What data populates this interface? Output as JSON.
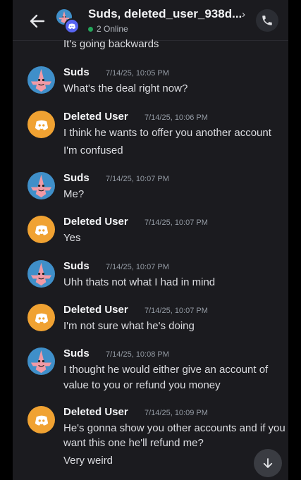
{
  "header": {
    "title": "Suds, deleted_user_938d...",
    "online": "2 Online"
  },
  "colors": {
    "background": "#1b1b1f",
    "discord_blurple": "#5865f2",
    "deleted_avatar": "#f0a232",
    "online_green": "#23a55a"
  },
  "messages": {
    "top_continuation": "It's going backwards",
    "m1": {
      "author": "Suds",
      "time": "7/14/25, 10:05 PM",
      "lines": [
        "What's the deal right now?"
      ]
    },
    "m2": {
      "author": "Deleted User",
      "time": "7/14/25, 10:06 PM",
      "lines": [
        "I think he wants to offer you another account",
        "I'm confused"
      ]
    },
    "m3": {
      "author": "Suds",
      "time": "7/14/25, 10:07 PM",
      "lines": [
        "Me?"
      ]
    },
    "m4": {
      "author": "Deleted User",
      "time": "7/14/25, 10:07 PM",
      "lines": [
        "Yes"
      ]
    },
    "m5": {
      "author": "Suds",
      "time": "7/14/25, 10:07 PM",
      "lines": [
        "Uhh thats not what I had in mind"
      ]
    },
    "m6": {
      "author": "Deleted User",
      "time": "7/14/25, 10:07 PM",
      "lines": [
        "I'm not sure what he's doing"
      ]
    },
    "m7": {
      "author": "Suds",
      "time": "7/14/25, 10:08 PM",
      "lines": [
        "I thought he would either give an account of",
        "value to you or refund you money"
      ]
    },
    "m8": {
      "author": "Deleted User",
      "time": "7/14/25, 10:09 PM",
      "lines": [
        "He's gonna show you other accounts and if you",
        "want this one he'll refund me?",
        "Very weird"
      ]
    }
  },
  "icons": {
    "back": "arrow-left-icon",
    "call": "phone-icon",
    "scroll": "arrow-down-icon",
    "deleted_avatar": "discord-logo-icon",
    "suds_avatar": "pink-starfish-avatar"
  }
}
